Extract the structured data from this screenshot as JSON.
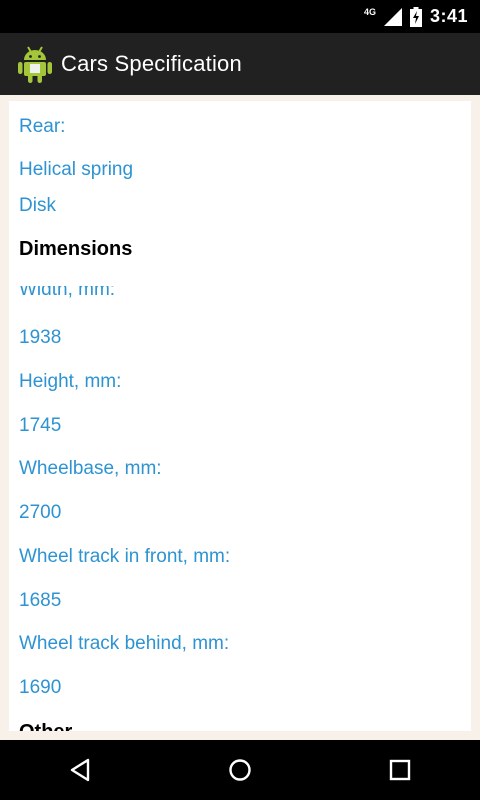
{
  "status": {
    "network": "4G",
    "time": "3:41"
  },
  "action_bar": {
    "title": "Cars Specification",
    "app_icon": "android-app-icon"
  },
  "spec": {
    "rear_label": "Rear:",
    "rear_values": [
      "Helical spring",
      "Disk"
    ],
    "dimensions_heading": "Dimensions",
    "width_label": "Width, mm:",
    "width_value": "1938",
    "height_label": "Height, mm:",
    "height_value": "1745",
    "wheelbase_label": "Wheelbase, mm:",
    "wheelbase_value": "2700",
    "track_front_label": "Wheel track in front, mm:",
    "track_front_value": "1685",
    "track_behind_label": "Wheel track behind, mm:",
    "track_behind_value": "1690",
    "other_heading": "Other"
  },
  "nav": {
    "back_icon": "back-icon",
    "home_icon": "home-icon",
    "recents_icon": "recents-icon"
  },
  "colors": {
    "link_blue": "#2d93d2",
    "action_bar": "#212121",
    "content_bg": "#f7f1e9"
  }
}
